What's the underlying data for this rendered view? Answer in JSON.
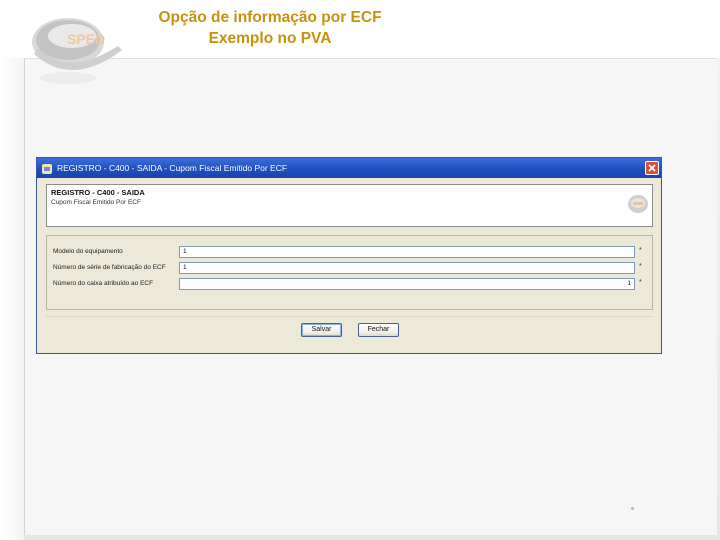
{
  "slide": {
    "title_line1": "Opção de informação por ECF",
    "title_line2": "Exemplo no PVA",
    "title_color": "#c8910e",
    "logo_text": "SPED"
  },
  "dialog": {
    "window_title": "REGISTRO - C400 - SAIDA - Cupom Fiscal Emitido Por ECF",
    "header_title": "REGISTRO - C400 - SAIDA",
    "header_subtitle": "Cupom Fiscal Emitido Por ECF",
    "fields": [
      {
        "label": "Modelo do equipamento",
        "value": "1",
        "required_mark": "*"
      },
      {
        "label": "Número de série de fabricação do ECF",
        "value": "1",
        "required_mark": "*"
      },
      {
        "label": "Número do caixa atribuído ao ECF",
        "value": "1",
        "required_mark": "*"
      }
    ],
    "buttons": {
      "save": "Salvar",
      "close": "Fechar"
    },
    "titlebar_color": "#2458c8",
    "close_color": "#d4533a"
  }
}
